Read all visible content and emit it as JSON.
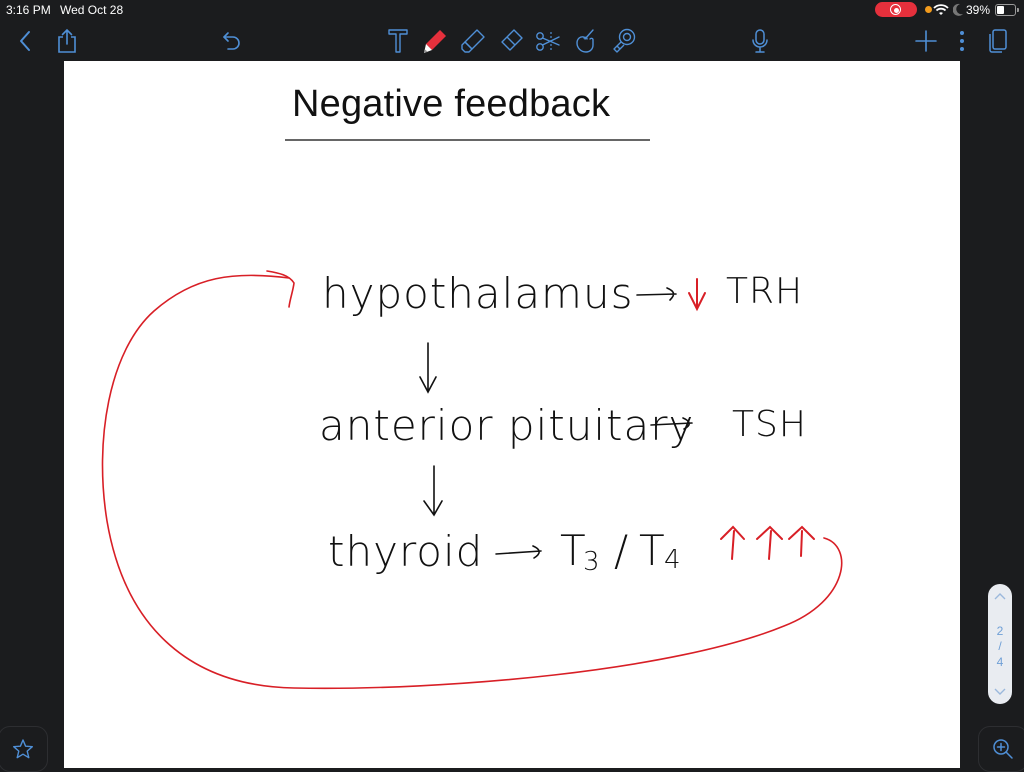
{
  "status_bar": {
    "time": "3:16 PM",
    "date": "Wed Oct 28",
    "battery_percent": "39%",
    "battery_level": 0.39,
    "recording_indicator": "screen-recording",
    "colors": {
      "recording": "#e5303c",
      "mic_dot": "#f29b1d"
    }
  },
  "toolbar": {
    "left": [
      {
        "icon": "chevron-left-icon",
        "label": "Back"
      },
      {
        "icon": "share-icon",
        "label": "Share"
      },
      {
        "icon": "undo-icon",
        "label": "Undo"
      }
    ],
    "tools": [
      {
        "icon": "text-tool-icon",
        "label": "Text",
        "active": false
      },
      {
        "icon": "pen-icon",
        "label": "Pen",
        "active": true
      },
      {
        "icon": "highlighter-icon",
        "label": "Highlighter",
        "active": false
      },
      {
        "icon": "eraser-icon",
        "label": "Eraser",
        "active": false
      },
      {
        "icon": "scissors-icon",
        "label": "Lasso / Cut",
        "active": false
      },
      {
        "icon": "hand-icon",
        "label": "Hand",
        "active": false
      },
      {
        "icon": "laser-pointer-icon",
        "label": "Laser pointer",
        "active": false
      }
    ],
    "right": [
      {
        "icon": "microphone-icon",
        "label": "Record audio"
      },
      {
        "icon": "plus-icon",
        "label": "Add page"
      },
      {
        "icon": "more-icon",
        "label": "More"
      },
      {
        "icon": "pages-icon",
        "label": "Pages"
      }
    ],
    "colors": {
      "icon": "#4f8fd6",
      "pen_active": "#e5303c"
    }
  },
  "page": {
    "title": "Negative feedback",
    "diagram": {
      "nodes": [
        {
          "id": "hypothalamus",
          "label": "hypothalamus",
          "output_arrow": "→",
          "output_modifier": "↓",
          "output": "TRH"
        },
        {
          "id": "anterior_pituitary",
          "label": "anterior pituitary",
          "output_arrow": "→",
          "output": "TSH"
        },
        {
          "id": "thyroid",
          "label": "thyroid",
          "output_arrow": "→",
          "output": "T3 / T4",
          "output_main": "T",
          "output_sub1": "3",
          "output_sep": "/",
          "output_main2": "T",
          "output_sub2": "4",
          "output_modifier": "↑↑↑"
        }
      ],
      "down_arrow": "↓",
      "feedback_loop": {
        "from": "thyroid",
        "to": "hypothalamus",
        "color": "#d81f26"
      },
      "ink_color": "#111111",
      "accent_color": "#d81f26"
    }
  },
  "page_navigator": {
    "current": "2",
    "separator": "/",
    "total": "4"
  },
  "bottom": {
    "favorite_icon": "star-icon",
    "zoom_icon": "zoom-in-icon"
  }
}
